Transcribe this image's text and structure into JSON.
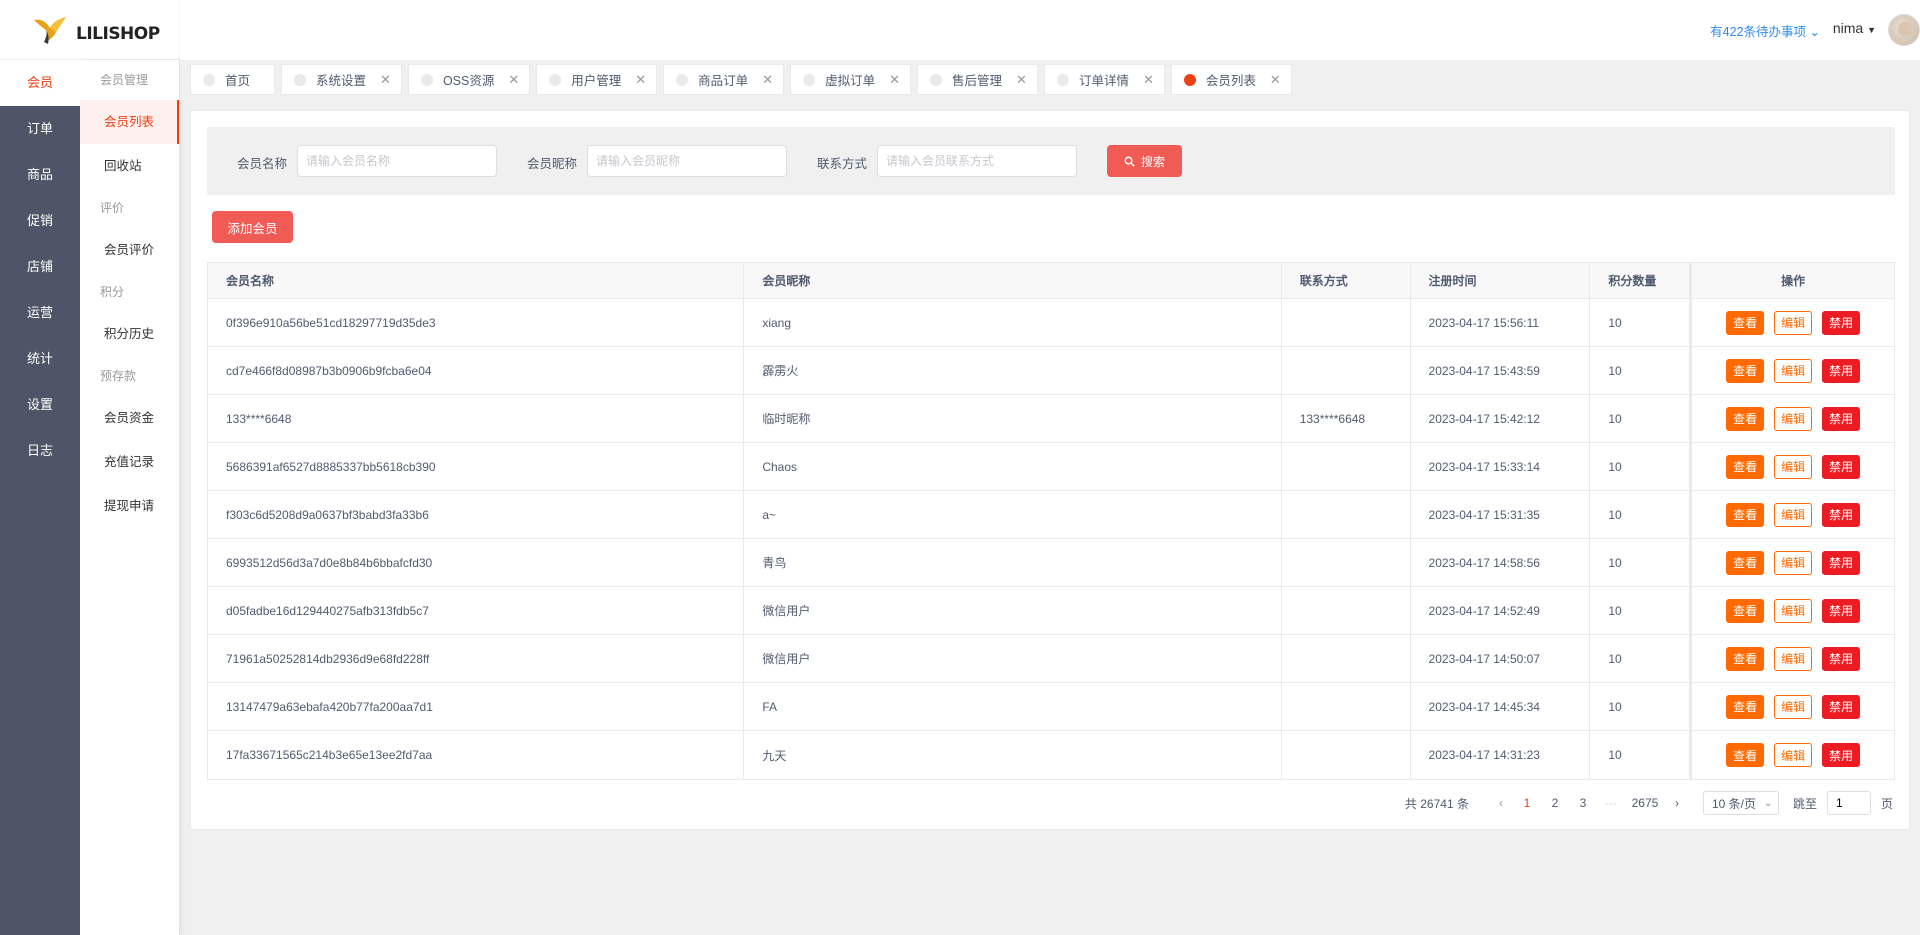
{
  "logo": {
    "text": "LILISHOP"
  },
  "header": {
    "todo": "有422条待办事项",
    "user": "nima"
  },
  "nav_main": [
    {
      "label": "会员",
      "active": true
    },
    {
      "label": "订单"
    },
    {
      "label": "商品"
    },
    {
      "label": "促销"
    },
    {
      "label": "店铺"
    },
    {
      "label": "运营"
    },
    {
      "label": "统计"
    },
    {
      "label": "设置"
    },
    {
      "label": "日志"
    }
  ],
  "nav_sub": {
    "group_member": "会员管理",
    "member_list": "会员列表",
    "recycle": "回收站",
    "group_review": "评价",
    "member_review": "会员评价",
    "group_points": "积分",
    "points_history": "积分历史",
    "group_deposit": "预存款",
    "member_funds": "会员资金",
    "recharge": "充值记录",
    "withdraw": "提现申请"
  },
  "tags": [
    {
      "label": "首页",
      "closable": false
    },
    {
      "label": "系统设置",
      "closable": true
    },
    {
      "label": "OSS资源",
      "closable": true
    },
    {
      "label": "用户管理",
      "closable": true
    },
    {
      "label": "商品订单",
      "closable": true
    },
    {
      "label": "虚拟订单",
      "closable": true
    },
    {
      "label": "售后管理",
      "closable": true
    },
    {
      "label": "订单详情",
      "closable": true
    },
    {
      "label": "会员列表",
      "closable": true,
      "active": true
    }
  ],
  "search": {
    "name_label": "会员名称",
    "name_placeholder": "请输入会员名称",
    "nickname_label": "会员昵称",
    "nickname_placeholder": "请输入会员昵称",
    "contact_label": "联系方式",
    "contact_placeholder": "请输入会员联系方式",
    "search_button": "搜索"
  },
  "add_button": "添加会员",
  "table": {
    "headers": [
      "会员名称",
      "会员昵称",
      "联系方式",
      "注册时间",
      "积分数量",
      "操作"
    ],
    "actions": {
      "view": "查看",
      "edit": "编辑",
      "ban": "禁用"
    },
    "rows": [
      {
        "name": "0f396e910a56be51cd18297719d35de3",
        "nickname": "xiang",
        "contact": "",
        "time": "2023-04-17 15:56:11",
        "points": "10"
      },
      {
        "name": "cd7e466f8d08987b3b0906b9fcba6e04",
        "nickname": "霹雳火",
        "contact": "",
        "time": "2023-04-17 15:43:59",
        "points": "10"
      },
      {
        "name": "133****6648",
        "nickname": "临时昵称",
        "contact": "133****6648",
        "time": "2023-04-17 15:42:12",
        "points": "10"
      },
      {
        "name": "5686391af6527d8885337bb5618cb390",
        "nickname": "Chaos",
        "contact": "",
        "time": "2023-04-17 15:33:14",
        "points": "10"
      },
      {
        "name": "f303c6d5208d9a0637bf3babd3fa33b6",
        "nickname": "a~",
        "contact": "",
        "time": "2023-04-17 15:31:35",
        "points": "10"
      },
      {
        "name": "6993512d56d3a7d0e8b84b6bbafcfd30",
        "nickname": "青鸟",
        "contact": "",
        "time": "2023-04-17 14:58:56",
        "points": "10"
      },
      {
        "name": "d05fadbe16d129440275afb313fdb5c7",
        "nickname": "微信用户",
        "contact": "",
        "time": "2023-04-17 14:52:49",
        "points": "10"
      },
      {
        "name": "71961a50252814db2936d9e68fd228ff",
        "nickname": "微信用户",
        "contact": "",
        "time": "2023-04-17 14:50:07",
        "points": "10"
      },
      {
        "name": "13147479a63ebafa420b77fa200aa7d1",
        "nickname": "FA",
        "contact": "",
        "time": "2023-04-17 14:45:34",
        "points": "10"
      },
      {
        "name": "17fa33671565c214b3e65e13ee2fd7aa",
        "nickname": "九天",
        "contact": "",
        "time": "2023-04-17 14:31:23",
        "points": "10"
      }
    ]
  },
  "pagination": {
    "total": "共 26741 条",
    "pages": [
      "1",
      "2",
      "3"
    ],
    "ellipsis": "···",
    "last": "2675",
    "current": "1",
    "page_size": "10 条/页",
    "jump_label": "跳至",
    "jump_value": "1",
    "page_suffix": "页"
  },
  "colors": {
    "accent": "#ed4014",
    "primary_button": "#f05b55",
    "sidebar_bg": "#4d5566",
    "link": "#2d8cf0"
  }
}
